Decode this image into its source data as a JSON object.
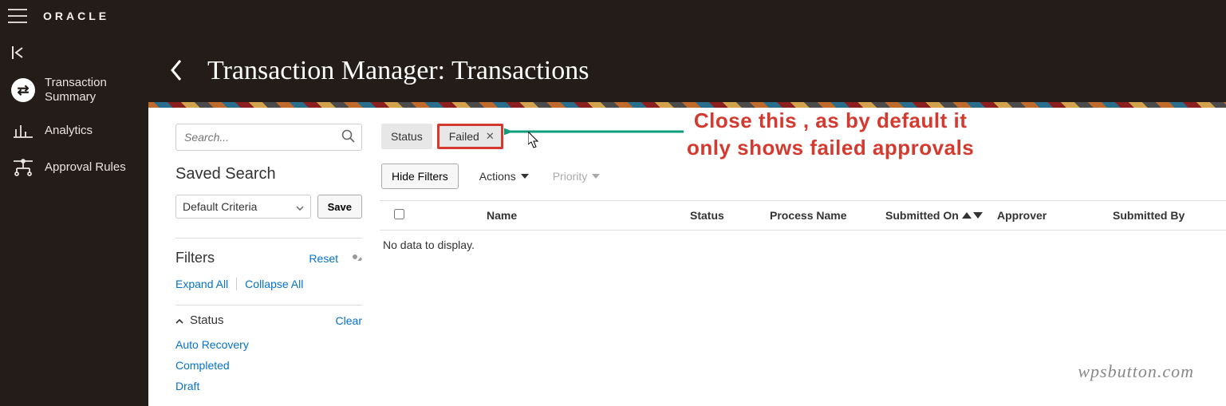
{
  "brand": "ORACLE",
  "sidebar": {
    "items": [
      {
        "label": "Transaction Summary"
      },
      {
        "label": "Analytics"
      },
      {
        "label": "Approval Rules"
      }
    ]
  },
  "page": {
    "title": "Transaction Manager: Transactions"
  },
  "search": {
    "placeholder": "Search..."
  },
  "saved_search": {
    "title": "Saved Search",
    "selected": "Default Criteria",
    "save_label": "Save"
  },
  "filters": {
    "title": "Filters",
    "reset": "Reset",
    "expand_all": "Expand All",
    "collapse_all": "Collapse All"
  },
  "status_section": {
    "title": "Status",
    "clear": "Clear",
    "options": [
      "Auto Recovery",
      "Completed",
      "Draft"
    ]
  },
  "chips": {
    "status_label": "Status",
    "failed_label": "Failed"
  },
  "toolbar": {
    "hide_filters": "Hide Filters",
    "actions": "Actions",
    "priority": "Priority"
  },
  "table": {
    "headers": {
      "name": "Name",
      "status": "Status",
      "process_name": "Process Name",
      "submitted_on": "Submitted On",
      "approver": "Approver",
      "submitted_by": "Submitted By"
    },
    "no_data": "No data to display."
  },
  "annotation": {
    "line1": "Close this , as by default it",
    "line2": "only shows failed approvals"
  },
  "watermark": "wpsbutton.com"
}
